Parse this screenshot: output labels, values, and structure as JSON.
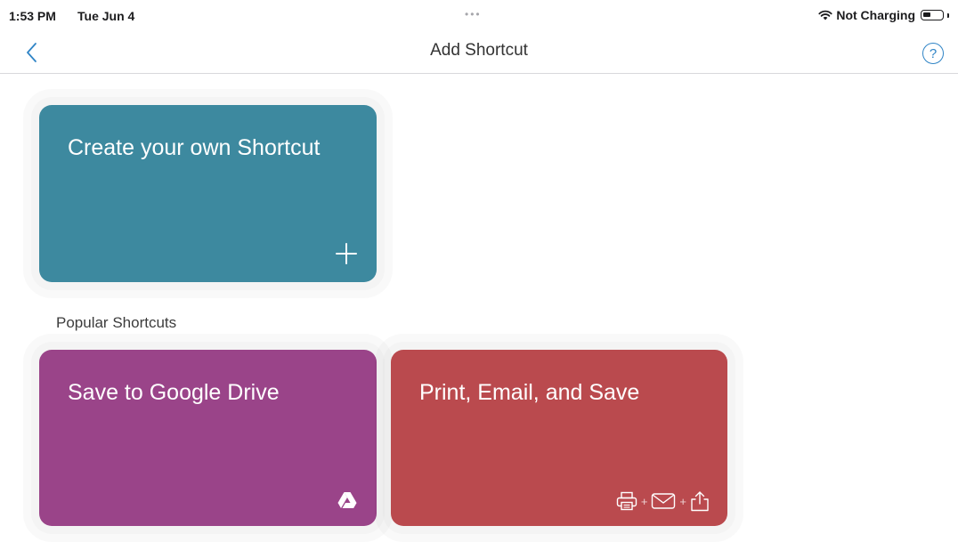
{
  "status_bar": {
    "time": "1:53 PM",
    "date": "Tue Jun 4",
    "dots": "•••",
    "wifi_icon": "wifi-icon",
    "charging": "Not Charging",
    "battery_icon": "battery-icon"
  },
  "nav": {
    "back_icon": "chevron-left-icon",
    "title": "Add Shortcut",
    "help_label": "?",
    "accent_color": "#2f84c6"
  },
  "create_card": {
    "title": "Create your own Shortcut",
    "icon": "plus-icon",
    "color": "#3d899f"
  },
  "section": {
    "popular_label": "Popular Shortcuts"
  },
  "popular": [
    {
      "title": "Save to Google Drive",
      "icon": "google-drive-icon",
      "color": "#9a4489"
    },
    {
      "title": "Print, Email, and Save",
      "icons": [
        "printer-icon",
        "envelope-icon",
        "share-icon"
      ],
      "separator": "+",
      "color": "#ba4a4e"
    }
  ]
}
